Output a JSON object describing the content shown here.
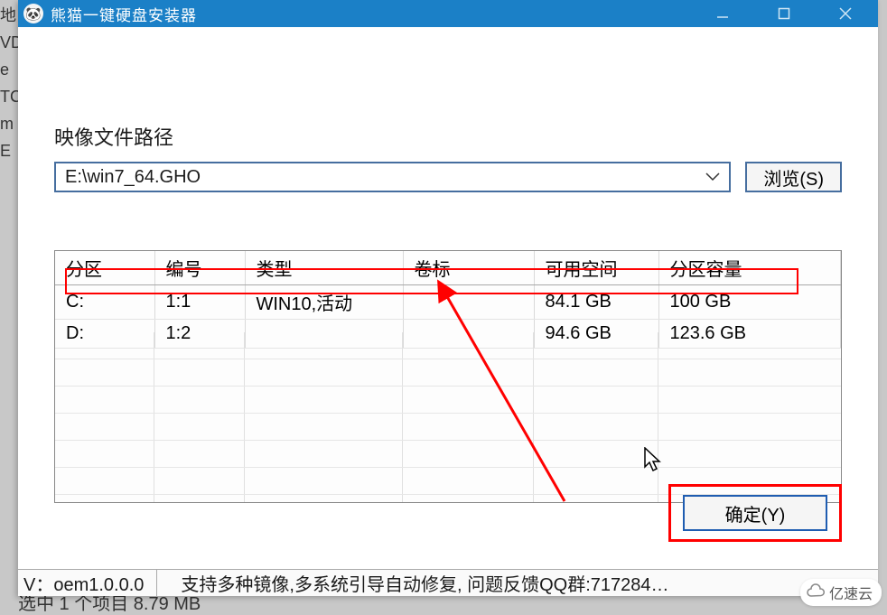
{
  "window": {
    "title": "熊猫一键硬盘安装器"
  },
  "bg_fragments": [
    "地",
    "VD",
    "e",
    "TC",
    "m",
    "E"
  ],
  "image_path": {
    "label": "映像文件路径",
    "value": "E:\\win7_64.GHO",
    "browse": "浏览(S)"
  },
  "table": {
    "headers": {
      "partition": "分区",
      "number": "编号",
      "type": "类型",
      "volume": "卷标",
      "free": "可用空间",
      "capacity": "分区容量"
    },
    "rows": [
      {
        "partition": "C:",
        "number": "1:1",
        "type": "WIN10,活动",
        "volume": "",
        "free": "84.1 GB",
        "capacity": "100 GB",
        "selected": true
      },
      {
        "partition": "D:",
        "number": "1:2",
        "type": "",
        "volume": "",
        "free": "94.6 GB",
        "capacity": "123.6 GB",
        "selected": false
      }
    ]
  },
  "ok_button": "确定(Y)",
  "status": {
    "version": "V：oem1.0.0.0",
    "message": "支持多种镜像,多系统引导自动修复, 问题反馈QQ群:717284…"
  },
  "underlying_status": "选中 1 个项目  8.79 MB",
  "watermark": "亿速云"
}
